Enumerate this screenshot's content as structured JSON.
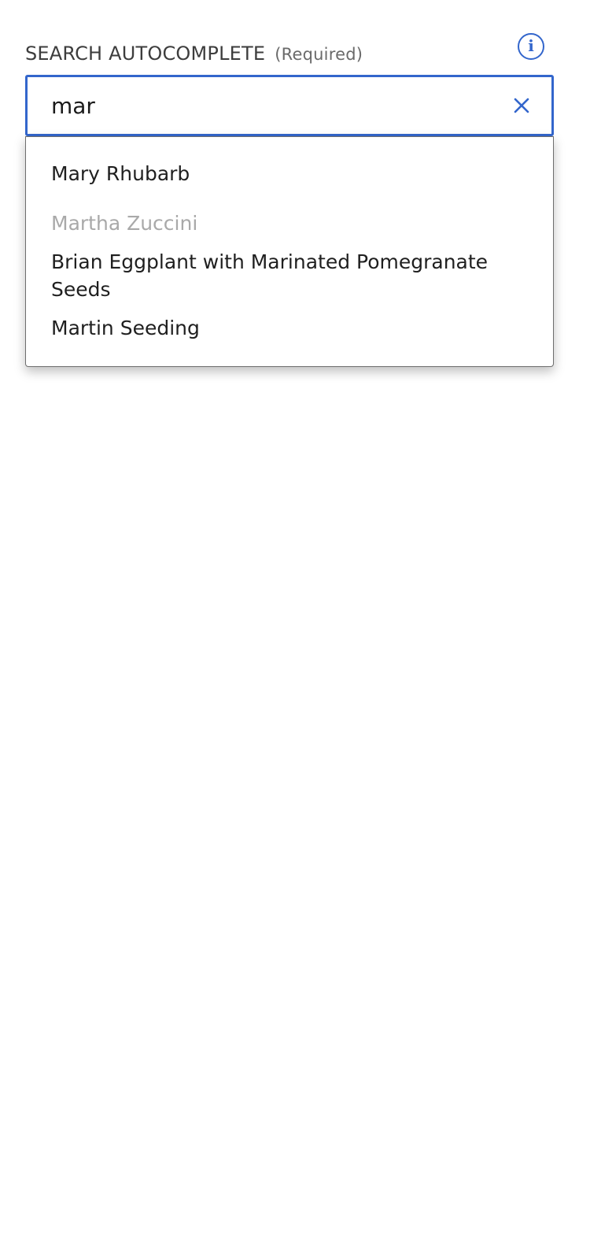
{
  "field": {
    "label": "SEARCH AUTOCOMPLETE",
    "required": "(Required)",
    "info_icon": "info-icon",
    "clear_icon": "close-icon"
  },
  "input": {
    "value": "mar"
  },
  "colors": {
    "accent": "#3366cc",
    "text": "#1f1f1f",
    "disabled_text": "#a9a9a9"
  },
  "options": [
    {
      "label": "Mary Rhubarb",
      "disabled": false
    },
    {
      "label": "Martha Zuccini",
      "disabled": true
    },
    {
      "label": "Brian Eggplant with Marinated Pomegranate Seeds",
      "disabled": false
    },
    {
      "label": "Martin Seeding",
      "disabled": false
    }
  ]
}
